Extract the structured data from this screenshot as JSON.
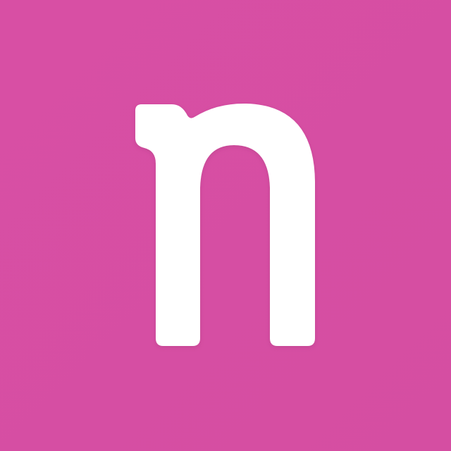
{
  "logo": {
    "name": "n-letter-logo",
    "letter": "n"
  },
  "colors": {
    "background": "#D64FA3",
    "glyph": "#FFFFFF"
  }
}
